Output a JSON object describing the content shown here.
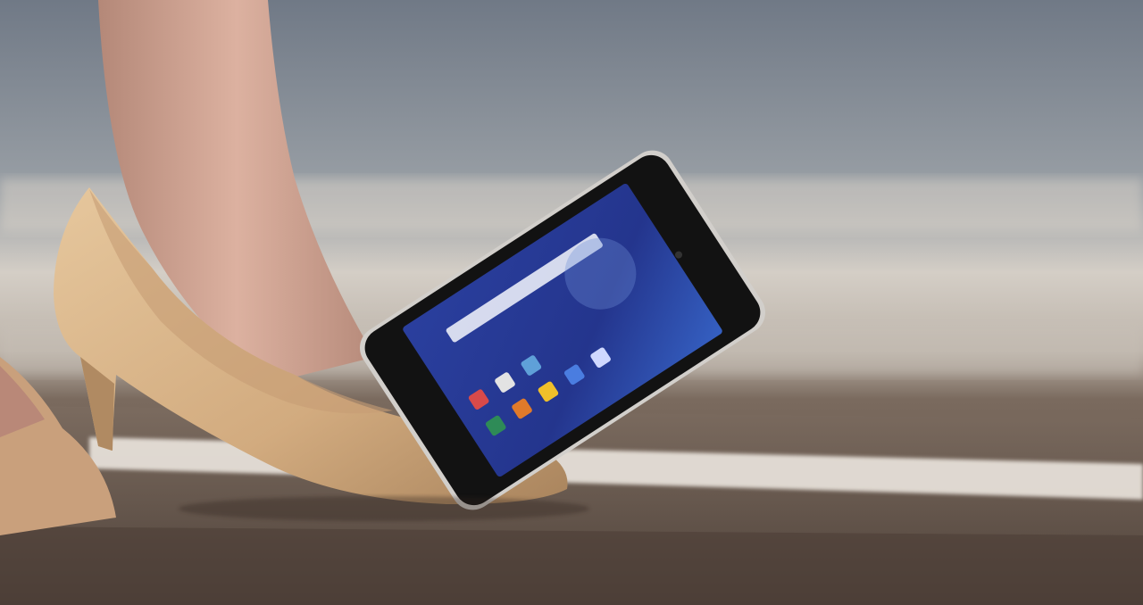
{
  "scene": {
    "description_hidden": "",
    "colors": {
      "sky_top": "#6f7986",
      "sky_bottom": "#b8b4ae",
      "pavement_light": "#d9d2c8",
      "pavement_dark": "#5a4d43",
      "asphalt": "#6b5a4e",
      "lane_line": "#efeae4",
      "shoe": "#d6b389",
      "shoe_shadow": "#a7825c",
      "skin": "#c99a8a",
      "phone_frame": "#151515",
      "phone_bezel_metal": "#c9c6c3",
      "screen_top": "#1f2f86",
      "screen_bottom": "#2f57b8"
    },
    "phone": {
      "app_icons": [
        {
          "name": "phone-app-icon",
          "color": "#2e8b57"
        },
        {
          "name": "messages-app-icon",
          "color": "#e07a2a"
        },
        {
          "name": "gallery-app-icon",
          "color": "#f0c02a"
        },
        {
          "name": "browser-app-icon",
          "color": "#4a7de0"
        },
        {
          "name": "camera-app-icon",
          "color": "#d84a4a"
        },
        {
          "name": "store-app-icon",
          "color": "#e3e3e3"
        },
        {
          "name": "apps-grid-icon",
          "color": "#cfd8ff"
        },
        {
          "name": "settings-app-icon",
          "color": "#5fa0d8"
        }
      ]
    }
  }
}
